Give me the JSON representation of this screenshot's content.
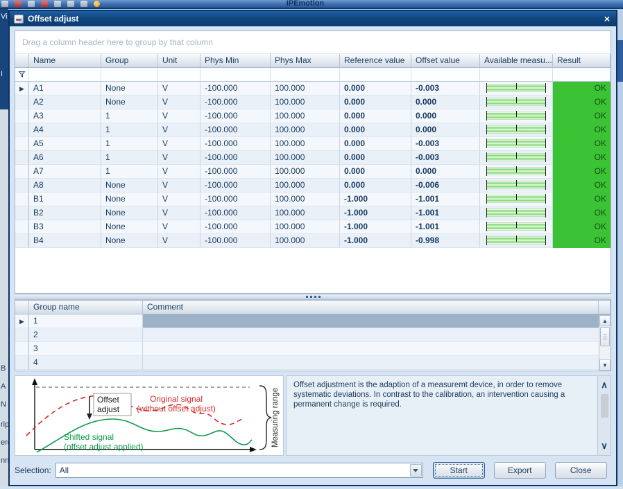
{
  "background": {
    "app_title": "IPEmotion",
    "left_fragments": {
      "f1": "Vi",
      "f2": "I",
      "f3": "B",
      "f4": "A",
      "f5": "N",
      "f6": "rip",
      "f7": "ere",
      "f8": "nn"
    }
  },
  "dialog": {
    "title": "Offset adjust",
    "close_glyph": "×"
  },
  "main_grid": {
    "group_hint": "Drag a column header here to group by that column",
    "columns": {
      "name": "Name",
      "group": "Group",
      "unit": "Unit",
      "phys_min": "Phys Min",
      "phys_max": "Phys Max",
      "reference": "Reference value",
      "offset": "Offset value",
      "available": "Available measu...",
      "result": "Result"
    },
    "rows": [
      {
        "name": "A1",
        "group": "None",
        "unit": "V",
        "phys_min": "-100.000",
        "phys_max": "100.000",
        "reference": "0.000",
        "offset": "-0.003",
        "result": "OK"
      },
      {
        "name": "A2",
        "group": "None",
        "unit": "V",
        "phys_min": "-100.000",
        "phys_max": "100.000",
        "reference": "0.000",
        "offset": "0.000",
        "result": "OK"
      },
      {
        "name": "A3",
        "group": "1",
        "unit": "V",
        "phys_min": "-100.000",
        "phys_max": "100.000",
        "reference": "0.000",
        "offset": "0.000",
        "result": "OK"
      },
      {
        "name": "A4",
        "group": "1",
        "unit": "V",
        "phys_min": "-100.000",
        "phys_max": "100.000",
        "reference": "0.000",
        "offset": "0.000",
        "result": "OK"
      },
      {
        "name": "A5",
        "group": "1",
        "unit": "V",
        "phys_min": "-100.000",
        "phys_max": "100.000",
        "reference": "0.000",
        "offset": "-0.003",
        "result": "OK"
      },
      {
        "name": "A6",
        "group": "1",
        "unit": "V",
        "phys_min": "-100.000",
        "phys_max": "100.000",
        "reference": "0.000",
        "offset": "-0.003",
        "result": "OK"
      },
      {
        "name": "A7",
        "group": "1",
        "unit": "V",
        "phys_min": "-100.000",
        "phys_max": "100.000",
        "reference": "0.000",
        "offset": "0.000",
        "result": "OK"
      },
      {
        "name": "A8",
        "group": "None",
        "unit": "V",
        "phys_min": "-100.000",
        "phys_max": "100.000",
        "reference": "0.000",
        "offset": "-0.006",
        "result": "OK"
      },
      {
        "name": "B1",
        "group": "None",
        "unit": "V",
        "phys_min": "-100.000",
        "phys_max": "100.000",
        "reference": "-1.000",
        "offset": "-1.001",
        "result": "OK"
      },
      {
        "name": "B2",
        "group": "None",
        "unit": "V",
        "phys_min": "-100.000",
        "phys_max": "100.000",
        "reference": "-1.000",
        "offset": "-1.001",
        "result": "OK"
      },
      {
        "name": "B3",
        "group": "None",
        "unit": "V",
        "phys_min": "-100.000",
        "phys_max": "100.000",
        "reference": "-1.000",
        "offset": "-1.001",
        "result": "OK"
      },
      {
        "name": "B4",
        "group": "None",
        "unit": "V",
        "phys_min": "-100.000",
        "phys_max": "100.000",
        "reference": "-1.000",
        "offset": "-0.998",
        "result": "OK"
      }
    ]
  },
  "group_grid": {
    "columns": {
      "group_name": "Group name",
      "comment": "Comment"
    },
    "rows": [
      {
        "group_name": "1",
        "comment": ""
      },
      {
        "group_name": "2",
        "comment": ""
      },
      {
        "group_name": "3",
        "comment": ""
      },
      {
        "group_name": "4",
        "comment": ""
      }
    ]
  },
  "info": {
    "diagram": {
      "offset_line1": "Offset",
      "offset_line2": "adjust",
      "original_line1": "Original signal",
      "original_line2": "(without offset adjust)",
      "shifted_line1": "Shifted signal",
      "shifted_line2": "(offset adjust applied)",
      "measuring_range": "Measuring range"
    },
    "description": "Offset adjustment is the adaption of a measuremt device, in order to remove systematic deviations. In contrast to the calibration, an intervention causing a permanent change is required."
  },
  "footer": {
    "selection_label": "Selection:",
    "selection_value": "All",
    "start_label": "Start",
    "export_label": "Export",
    "close_label": "Close"
  },
  "colors": {
    "result_ok_green": "#3cc335",
    "titlebar_navy": "#0b3a72",
    "signal_red": "#d82a2a",
    "signal_green": "#0d9a4a"
  }
}
